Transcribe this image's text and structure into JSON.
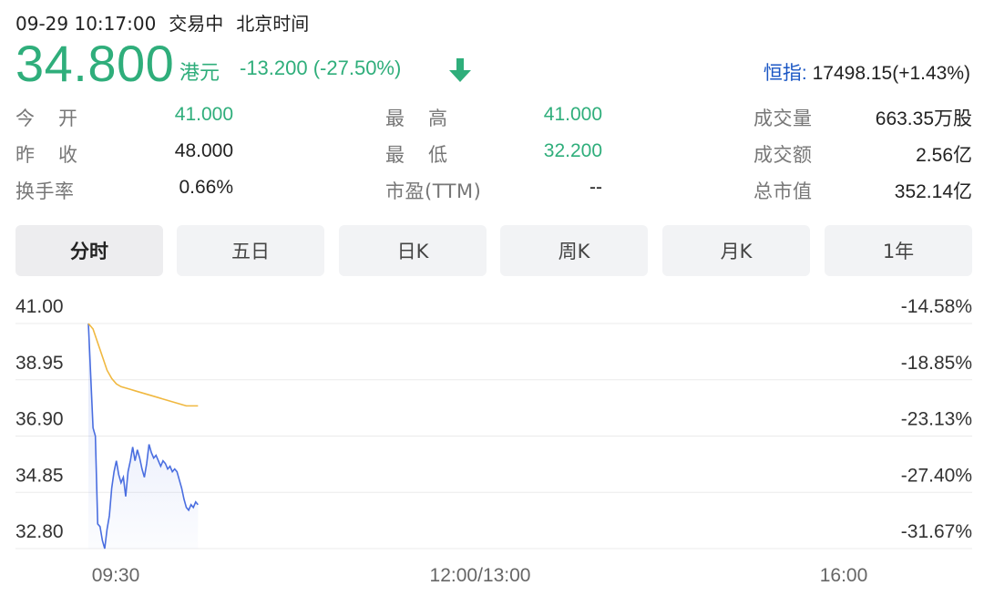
{
  "header": {
    "datetime": "09-29 10:17:00",
    "status": "交易中",
    "timezone": "北京时间"
  },
  "quote": {
    "price": "34.800",
    "currency": "港元",
    "change": "-13.200 (-27.50%)",
    "direction_icon": "arrow-down-icon",
    "index_label": "恒指:",
    "index_value": "17498.15(+1.43%)"
  },
  "stats": {
    "open_label": "今开",
    "open_value": "41.000",
    "high_label": "最高",
    "high_value": "41.000",
    "volume_label": "成交量",
    "volume_value": "663.35万股",
    "prev_close_label": "昨收",
    "prev_close_value": "48.000",
    "low_label": "最低",
    "low_value": "32.200",
    "turnover_label": "成交额",
    "turnover_value": "2.56亿",
    "turnover_rate_label": "换手率",
    "turnover_rate_value": "0.66%",
    "pe_label": "市盈(TTM)",
    "pe_value": "--",
    "market_cap_label": "总市值",
    "market_cap_value": "352.14亿"
  },
  "tabs": [
    {
      "label": "分时",
      "active": true
    },
    {
      "label": "五日",
      "active": false
    },
    {
      "label": "日K",
      "active": false
    },
    {
      "label": "周K",
      "active": false
    },
    {
      "label": "月K",
      "active": false
    },
    {
      "label": "1年",
      "active": false
    }
  ],
  "colors": {
    "up_down_green": "#2fae7b",
    "price_line": "#4a6ee0",
    "avg_line": "#f0b840",
    "index_label_blue": "#1a56c4"
  },
  "chart_data": {
    "type": "line",
    "y_ticks": [
      "41.00",
      "38.95",
      "36.90",
      "34.85",
      "32.80"
    ],
    "y_pct_ticks": [
      "-14.58%",
      "-18.85%",
      "-23.13%",
      "-27.40%",
      "-31.67%"
    ],
    "x_ticks": [
      "09:30",
      "12:00/13:00",
      "16:00"
    ],
    "ylim": [
      32.8,
      41.0
    ],
    "series": [
      {
        "role": "price",
        "x": [
          0,
          2,
          3,
          4,
          5,
          6,
          7,
          8,
          9,
          10,
          11,
          12,
          13,
          14,
          15,
          16,
          17,
          18,
          19,
          20,
          21,
          22,
          23,
          24,
          25,
          26,
          27,
          28,
          29,
          30,
          31,
          32,
          33,
          34,
          35,
          36,
          37,
          38,
          39,
          40,
          41,
          42,
          43,
          44,
          45,
          46,
          47
        ],
        "values": [
          41.0,
          37.2,
          36.9,
          33.7,
          33.6,
          33.1,
          32.8,
          33.5,
          34.0,
          35.0,
          35.6,
          36.0,
          35.5,
          35.2,
          35.4,
          34.7,
          35.6,
          36.0,
          36.5,
          36.0,
          36.4,
          36.1,
          35.7,
          35.4,
          35.9,
          36.6,
          36.3,
          36.1,
          36.2,
          36.0,
          35.8,
          36.0,
          35.9,
          35.7,
          35.8,
          35.6,
          35.7,
          35.6,
          35.3,
          35.0,
          34.6,
          34.3,
          34.2,
          34.4,
          34.3,
          34.5,
          34.4
        ]
      },
      {
        "role": "average",
        "x": [
          0,
          2,
          4,
          6,
          8,
          10,
          12,
          14,
          16,
          18,
          20,
          22,
          24,
          26,
          28,
          30,
          32,
          34,
          36,
          38,
          40,
          42,
          44,
          46,
          47
        ],
        "values": [
          41.0,
          40.8,
          40.3,
          39.8,
          39.3,
          39.0,
          38.8,
          38.7,
          38.65,
          38.6,
          38.55,
          38.5,
          38.45,
          38.4,
          38.35,
          38.3,
          38.25,
          38.2,
          38.15,
          38.1,
          38.05,
          38.0,
          38.0,
          38.0,
          38.0
        ]
      }
    ]
  }
}
